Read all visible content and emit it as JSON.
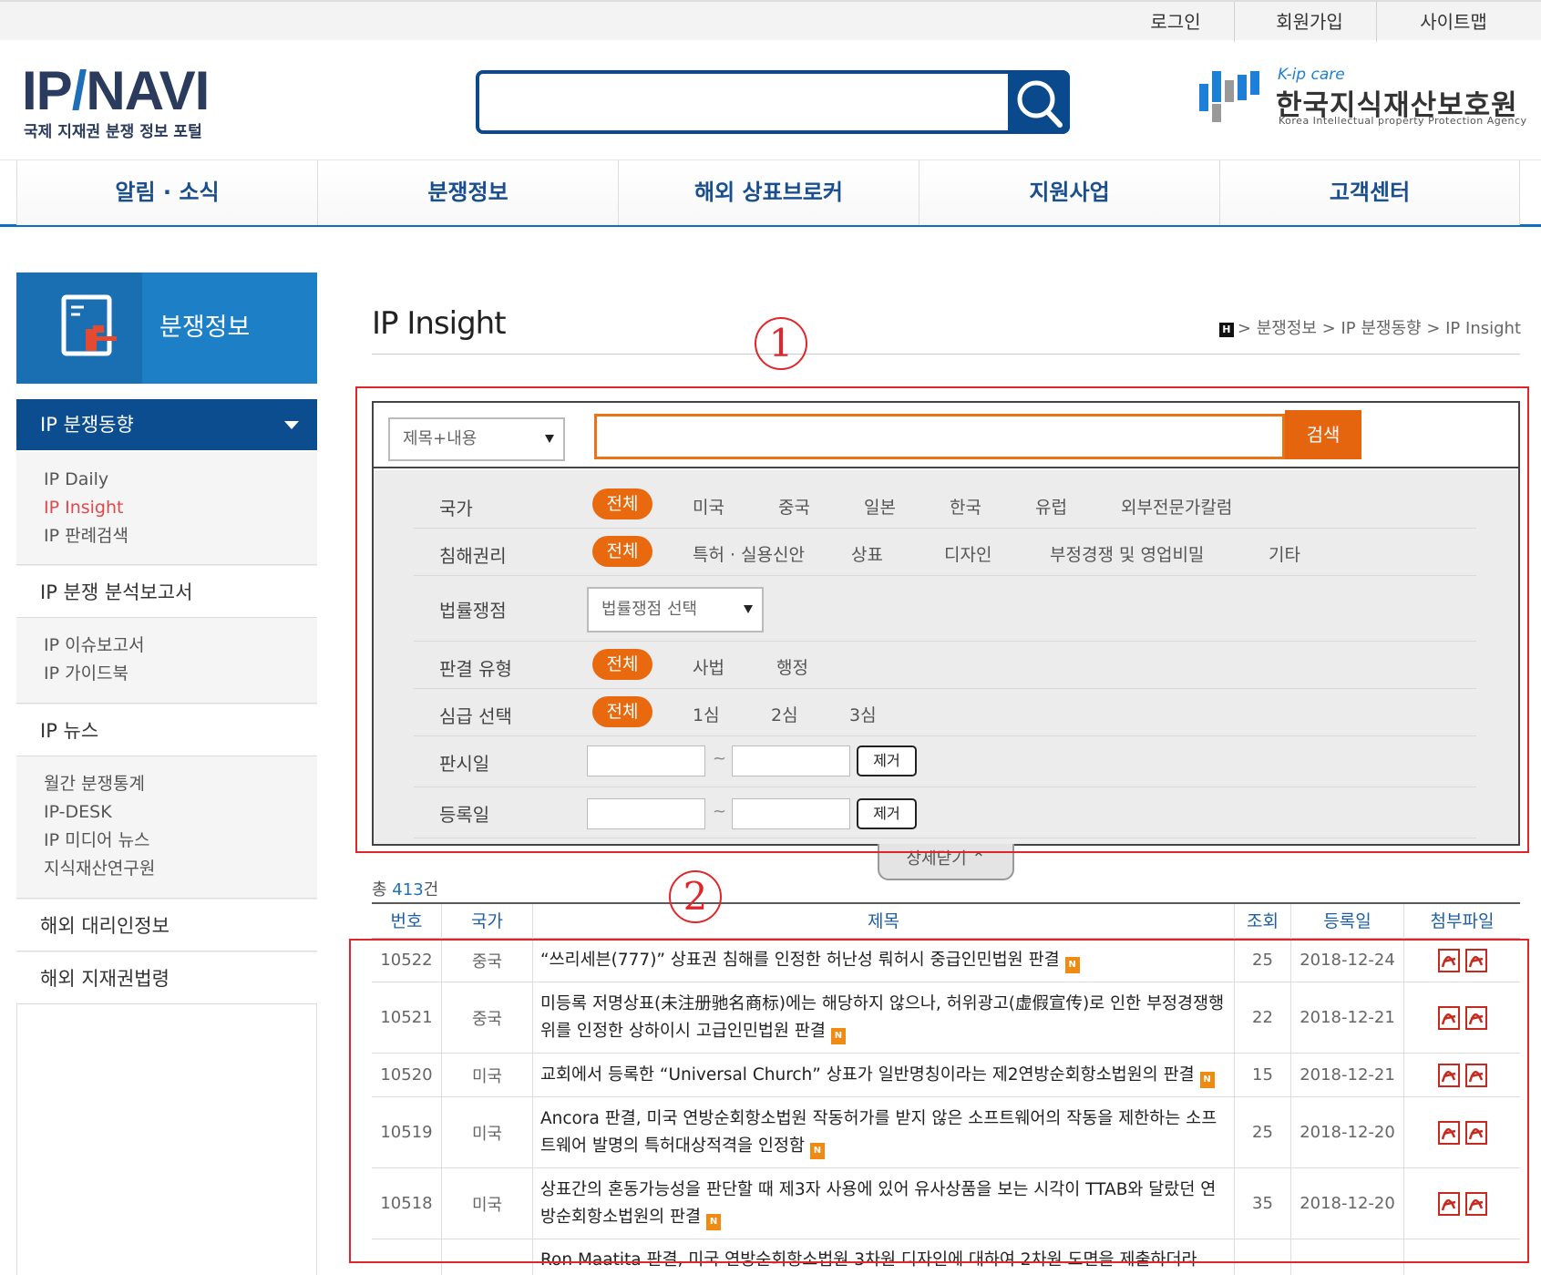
{
  "topbar": {
    "login": "로그인",
    "signup": "회원가입",
    "sitemap": "사이트맵"
  },
  "header": {
    "logo_text_a": "IP",
    "logo_text_b": "NAVI",
    "logo_sub": "국제 지재권 분쟁 정보 포털",
    "search_placeholder": "",
    "kipa_tag": "K-ip care",
    "kipa_name": "한국지식재산보호원",
    "kipa_en": "Korea Intellectual property Protection Agency"
  },
  "nav": [
    "알림 · 소식",
    "분쟁정보",
    "해외 상표브로커",
    "지원사업",
    "고객센터"
  ],
  "sidebar": {
    "head_title": "분쟁정보",
    "active": "IP 분쟁동향",
    "group1": [
      "IP Daily",
      "IP Insight",
      "IP 판례검색"
    ],
    "cat_report": "IP 분쟁 분석보고서",
    "group2": [
      "IP 이슈보고서",
      "IP 가이드북"
    ],
    "cat_news": "IP 뉴스",
    "group3": [
      "월간 분쟁통계",
      "IP-DESK",
      "IP 미디어 뉴스",
      "지식재산연구원"
    ],
    "cat_agent": "해외 대리인정보",
    "cat_law": "해외 지재권법령"
  },
  "page": {
    "title": "IP Insight",
    "breadcrumb_home": "H",
    "breadcrumb": "> 분쟁정보 > IP 분쟁동향 > IP Insight"
  },
  "annotations": {
    "a1": "1",
    "a2": "2"
  },
  "filter": {
    "scope_select": "제목+내용",
    "keyword_value": "",
    "search_button": "검색",
    "country_label": "국가",
    "country_options": [
      "전체",
      "미국",
      "중국",
      "일본",
      "한국",
      "유럽",
      "외부전문가칼럼"
    ],
    "right_label": "침해권리",
    "right_options": [
      "전체",
      "특허 · 실용신안",
      "상표",
      "디자인",
      "부정경쟁 및 영업비밀",
      "기타"
    ],
    "issue_label": "법률쟁점",
    "issue_select": "법률쟁점 선택",
    "type_label": "판결 유형",
    "type_options": [
      "전체",
      "사법",
      "행정"
    ],
    "level_label": "심급 선택",
    "level_options": [
      "전체",
      "1심",
      "2심",
      "3심"
    ],
    "date1_label": "판시일",
    "date2_label": "등록일",
    "tilde": "~",
    "remove_button": "제거",
    "collapse_label": "상세닫기 ⌃"
  },
  "list": {
    "total_prefix": "총 ",
    "total_count": "413",
    "total_suffix": "건",
    "columns": [
      "번호",
      "국가",
      "제목",
      "조회",
      "등록일",
      "첨부파일"
    ],
    "rows": [
      {
        "no": "10522",
        "country": "중국",
        "title": "“쓰리세븐(777)” 상표권 침해를 인정한 허난성 뤄허시 중급인민법원 판결",
        "views": "25",
        "date": "2018-12-24"
      },
      {
        "no": "10521",
        "country": "중국",
        "title": "미등록 저명상표(未注册驰名商标)에는 해당하지 않으나, 허위광고(虚假宣传)로 인한 부정경쟁행위를 인정한 상하이시 고급인민법원 판결",
        "views": "22",
        "date": "2018-12-21"
      },
      {
        "no": "10520",
        "country": "미국",
        "title": "교회에서 등록한 “Universal Church” 상표가 일반명칭이라는 제2연방순회항소법원의 판결",
        "views": "15",
        "date": "2018-12-21"
      },
      {
        "no": "10519",
        "country": "미국",
        "title": "Ancora 판결, 미국 연방순회항소법원 작동허가를 받지 않은 소프트웨어의 작동을 제한하는 소프트웨어 발명의 특허대상적격을 인정함",
        "views": "25",
        "date": "2018-12-20"
      },
      {
        "no": "10518",
        "country": "미국",
        "title": "상표간의 혼동가능성을 판단할 때 제3자 사용에 있어 유사상품을 보는 시각이 TTAB와 달랐던 연방순회항소법원의 판결",
        "views": "35",
        "date": "2018-12-20"
      },
      {
        "no": "",
        "country": "",
        "title": "Ron Maatita 판결, 미국 연방순회항소법원 3차원 디자인에 대하여 2차원 도면을 제출하더라",
        "views": "",
        "date": ""
      }
    ],
    "new_badge": "N"
  },
  "colors": {
    "accent_orange": "#e9690f",
    "nav_blue": "#0b4d8e",
    "annotation_red": "#e0262b"
  }
}
